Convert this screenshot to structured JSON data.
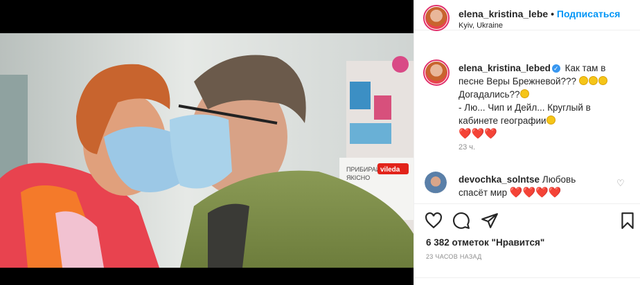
{
  "post": {
    "username": "elena_kristina_lebed",
    "header_username": "elena_kristina_lebe",
    "dot": "•",
    "follow_label": "Подписаться",
    "location": "Kyiv, Ukraine",
    "caption_line1": "Как там в",
    "caption_line2": "песне Веры Брежневой???",
    "caption_line3": "Догадались??",
    "caption_line4": "- Лю... Чип и Дейл... Круглый в",
    "caption_line5": "кабинете географии",
    "caption_hearts": "❤️❤️❤️",
    "caption_time": "23 ч."
  },
  "comment": {
    "username": "devochka_solntse",
    "text1": "Любовь",
    "text2": "спасёт мир",
    "hearts": "❤️❤️❤️❤️"
  },
  "actions": {
    "likes": "6 382 отметок \"Нравится\"",
    "time": "23 часов назад"
  },
  "icons": [
    "like-icon",
    "comment-icon",
    "share-icon",
    "save-icon",
    "verified-icon"
  ],
  "colors": {
    "follow": "#0095f6",
    "verified": "#3897f0",
    "heart": "#e0102e",
    "muted": "#8e8e8e"
  }
}
